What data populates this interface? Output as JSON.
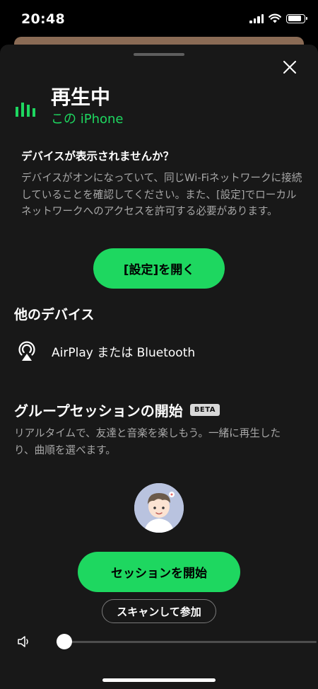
{
  "status_bar": {
    "time": "20:48",
    "icons": [
      "signal-icon",
      "wifi-icon",
      "battery-icon"
    ]
  },
  "sheet": {
    "close_icon": "close-icon",
    "now_playing": {
      "icon": "equalizer-icon",
      "title": "再生中",
      "device": "この iPhone"
    },
    "no_devices": {
      "heading": "デバイスが表示されませんか？",
      "body": "デバイスがオンになっていて、同じWi-Fiネットワークに接続していることを確認してください。また、[設定]でローカルネットワークへのアクセスを許可する必要があります。"
    },
    "open_settings_label": "[設定]を開く",
    "other_devices": {
      "heading": "他のデバイス",
      "airplay_label": "AirPlay または Bluetooth",
      "airplay_icon": "airplay-icon"
    },
    "group_session": {
      "heading": "グループセッションの開始",
      "badge": "BETA",
      "body": "リアルタイムで、友達と音楽を楽しもう。一緒に再生したり、曲順を選べます。",
      "start_label": "セッションを開始",
      "scan_label": "スキャンして参加"
    },
    "volume": {
      "icon": "speaker-icon",
      "level": 0.03
    }
  },
  "colors": {
    "accent": "#1ed760",
    "sheet_bg": "#181818",
    "secondary_text": "#a7a7a7"
  }
}
